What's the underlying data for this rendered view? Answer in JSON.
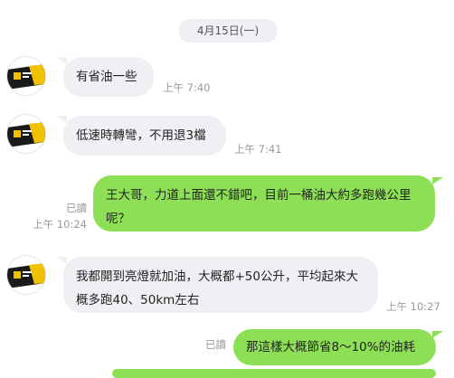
{
  "date_divider": "4月15日(一)",
  "colors": {
    "incoming_bubble": "#eef0f3",
    "outgoing_bubble": "#8de055",
    "meta_text": "#999999"
  },
  "messages": [
    {
      "direction": "in",
      "text": "有省油一些",
      "time": "上午 7:40"
    },
    {
      "direction": "in",
      "text": "低速時轉彎，不用退3檔",
      "time": "上午 7:41"
    },
    {
      "direction": "out",
      "text": "王大哥，力道上面還不錯吧，目前一桶油大約多跑幾公里呢？",
      "status": "已讀",
      "time": "上午 10:24"
    },
    {
      "direction": "in",
      "text": "我都開到亮燈就加油，大概都+50公升，平均起來大概多跑40、50km左右",
      "time": "上午 10:27"
    },
    {
      "direction": "out",
      "text": "那這樣大概節省8～10%的油耗",
      "status": "已讀",
      "time": ""
    },
    {
      "direction": "out",
      "text": "",
      "status": "",
      "time": ""
    }
  ],
  "avatar": {
    "icon": "company-logo-avatar"
  }
}
